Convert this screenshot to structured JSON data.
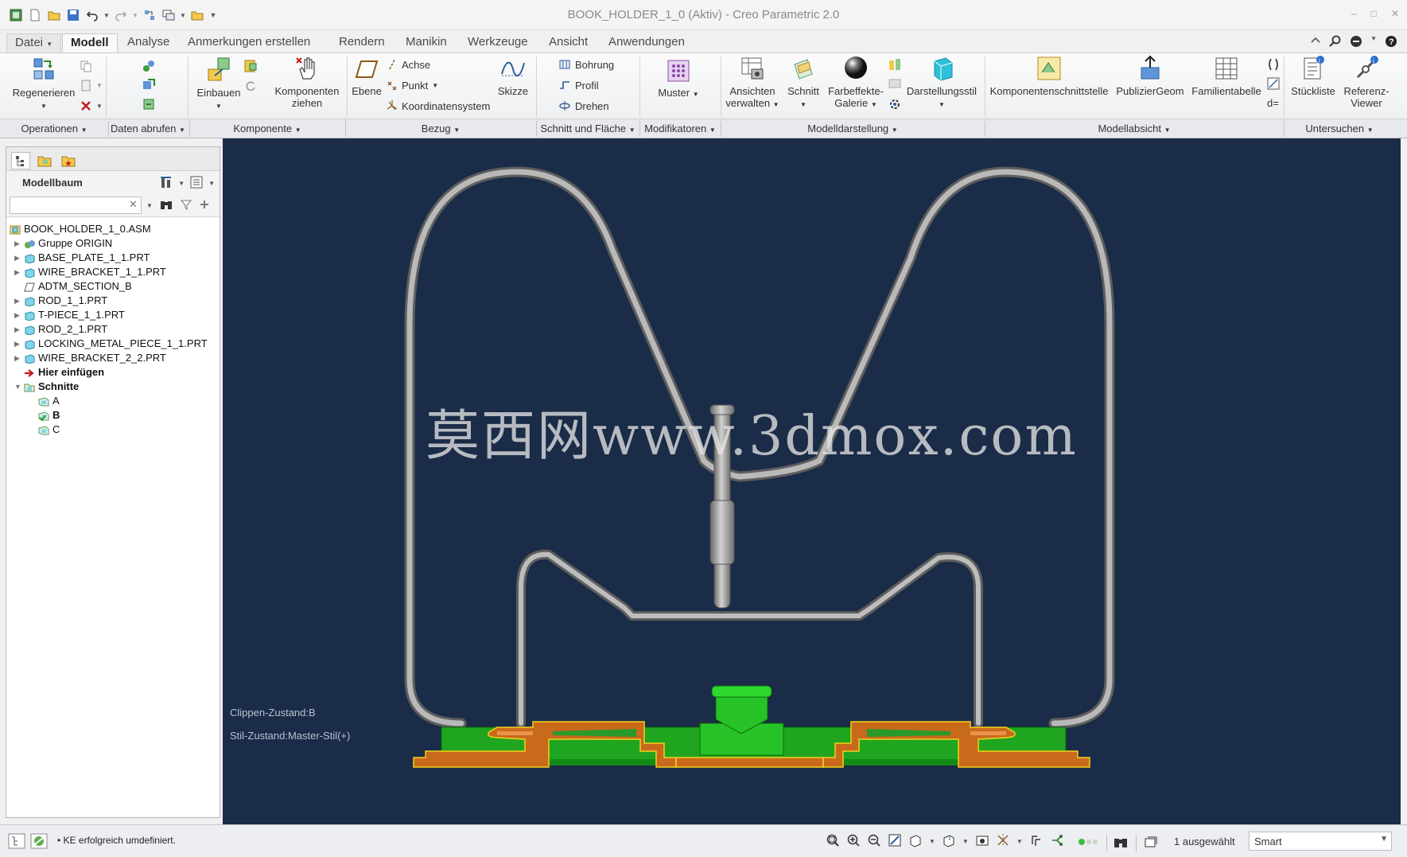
{
  "window": {
    "title": "BOOK_HOLDER_1_0 (Aktiv) - Creo Parametric 2.0"
  },
  "tabs": [
    {
      "label": "Datei"
    },
    {
      "label": "Modell"
    },
    {
      "label": "Analyse"
    },
    {
      "label": "Anmerkungen erstellen"
    },
    {
      "label": "Rendern"
    },
    {
      "label": "Manikin"
    },
    {
      "label": "Werkzeuge"
    },
    {
      "label": "Ansicht"
    },
    {
      "label": "Anwendungen"
    }
  ],
  "ribbon": {
    "regenerate": "Regenerieren",
    "assemble": "Einbauen",
    "drag_line1": "Komponenten",
    "drag_line2": "ziehen",
    "plane": "Ebene",
    "axis": "Achse",
    "point": "Punkt",
    "csys": "Koordinatensystem",
    "sketch": "Skizze",
    "hole": "Bohrung",
    "profile": "Profil",
    "revolve": "Drehen",
    "pattern": "Muster",
    "views_line1": "Ansichten",
    "views_line2": "verwalten",
    "section": "Schnitt",
    "appearance_line1": "Farbeffekte-",
    "appearance_line2": "Galerie",
    "display_style": "Darstellungsstil",
    "comp_interface": "Komponentenschnittstelle",
    "publish_geom": "PublizierGeom",
    "family_table": "Familientabelle",
    "bom": "Stückliste",
    "ref_viewer_line1": "Referenz-",
    "ref_viewer_line2": "Viewer"
  },
  "groups": [
    {
      "label": "Operationen"
    },
    {
      "label": "Daten abrufen"
    },
    {
      "label": "Komponente"
    },
    {
      "label": "Bezug"
    },
    {
      "label": "Schnitt und Fläche"
    },
    {
      "label": "Modifikatoren"
    },
    {
      "label": "Modelldarstellung"
    },
    {
      "label": "Modellabsicht"
    },
    {
      "label": "Untersuchen"
    }
  ],
  "model_tree": {
    "title": "Modellbaum",
    "search_value": "",
    "items": [
      {
        "label": "BOOK_HOLDER_1_0.ASM",
        "expander": "",
        "icon": "assembly-icon"
      },
      {
        "label": "Gruppe ORIGIN",
        "expander": "▶",
        "icon": "group-icon"
      },
      {
        "label": "BASE_PLATE_1_1.PRT",
        "expander": "▶",
        "icon": "part-icon"
      },
      {
        "label": "WIRE_BRACKET_1_1.PRT",
        "expander": "▶",
        "icon": "part-icon"
      },
      {
        "label": "ADTM_SECTION_B",
        "expander": "",
        "icon": "datum-plane-icon"
      },
      {
        "label": "ROD_1_1.PRT",
        "expander": "▶",
        "icon": "part-icon"
      },
      {
        "label": "T-PIECE_1_1.PRT",
        "expander": "▶",
        "icon": "part-icon"
      },
      {
        "label": "ROD_2_1.PRT",
        "expander": "▶",
        "icon": "part-icon"
      },
      {
        "label": "LOCKING_METAL_PIECE_1_1.PRT",
        "expander": "▶",
        "icon": "part-icon"
      },
      {
        "label": "WIRE_BRACKET_2_2.PRT",
        "expander": "▶",
        "icon": "part-icon"
      },
      {
        "label": "Hier einfügen",
        "expander": "",
        "icon": "insert-here-icon"
      },
      {
        "label": "Schnitte",
        "expander": "▼",
        "icon": "sections-folder-icon"
      },
      {
        "label": "A",
        "expander": "",
        "icon": "section-icon"
      },
      {
        "label": "B",
        "expander": "",
        "icon": "section-active-icon"
      },
      {
        "label": "C",
        "expander": "",
        "icon": "section-icon"
      }
    ]
  },
  "viewport": {
    "clip_state": "Clippen-Zustand:B",
    "style_state": "Stil-Zustand:Master-Stil(+)",
    "watermark": "莫西网www.3dmox.com",
    "background_color": "#1a2c47",
    "wire_color": "#a9a9a9",
    "part_green": "#22b422",
    "section_orange": "#c8691c"
  },
  "status": {
    "message": "KE erfolgreich umdefiniert.",
    "selected": "1 ausgewählt",
    "filter": "Smart"
  }
}
